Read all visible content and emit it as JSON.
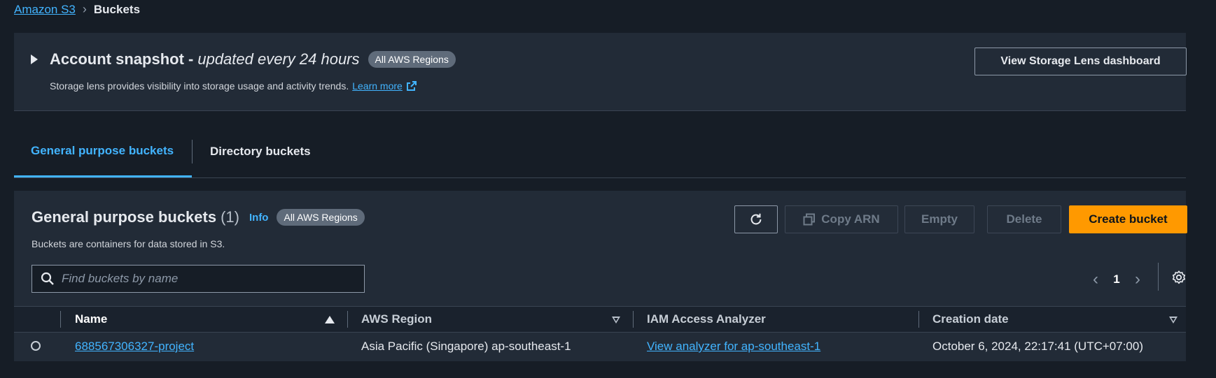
{
  "breadcrumb": {
    "root": "Amazon S3",
    "current": "Buckets"
  },
  "snapshot": {
    "title": "Account snapshot -",
    "title_suffix": "updated every 24 hours",
    "badge": "All AWS Regions",
    "description": "Storage lens provides visibility into storage usage and activity trends.",
    "learn_more": "Learn more",
    "button": "View Storage Lens dashboard"
  },
  "tabs": [
    {
      "label": "General purpose buckets",
      "active": true
    },
    {
      "label": "Directory buckets",
      "active": false
    }
  ],
  "panel": {
    "title": "General purpose buckets",
    "count": "(1)",
    "info": "Info",
    "badge": "All AWS Regions",
    "description": "Buckets are containers for data stored in S3.",
    "actions": {
      "copy_arn": "Copy ARN",
      "empty": "Empty",
      "delete": "Delete",
      "create": "Create bucket"
    },
    "search": {
      "placeholder": "Find buckets by name",
      "value": ""
    },
    "page": "1"
  },
  "table": {
    "columns": [
      "Name",
      "AWS Region",
      "IAM Access Analyzer",
      "Creation date"
    ],
    "rows": [
      {
        "name": "688567306327-project",
        "region": "Asia Pacific (Singapore) ap-southeast-1",
        "analyzer": "View analyzer for ap-southeast-1",
        "created": "October 6, 2024, 22:17:41 (UTC+07:00)"
      }
    ]
  },
  "colors": {
    "accent_link": "#42b4ff",
    "primary_button": "#ff9900",
    "background": "#161d26",
    "panel": "#222b37"
  }
}
